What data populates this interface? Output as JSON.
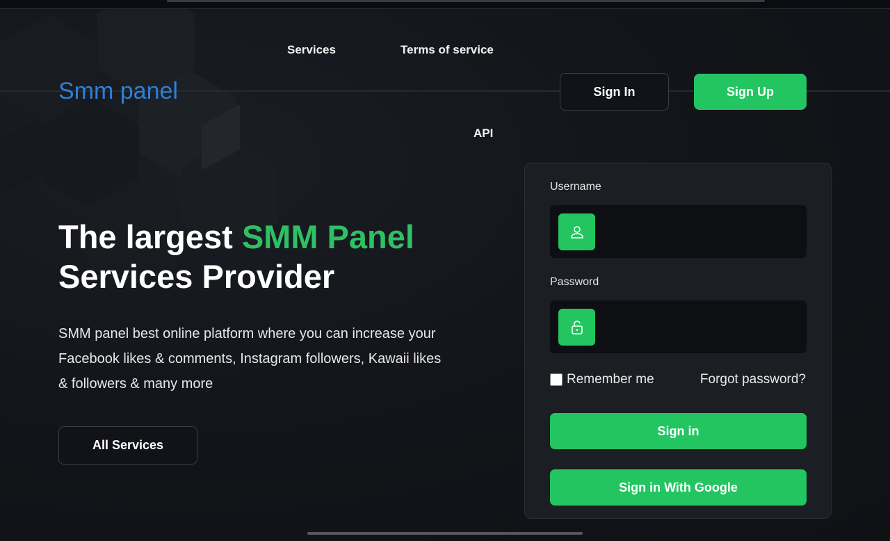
{
  "nav": {
    "services": "Services",
    "terms": "Terms of service",
    "api": "API"
  },
  "logo": "Smm panel",
  "header": {
    "signin_label": "Sign In",
    "signup_label": "Sign Up"
  },
  "hero": {
    "title_part1": "The largest ",
    "title_accent": "SMM Panel",
    "title_part2": "Services Provider",
    "description": "SMM panel best online platform where you can increase your Facebook likes & comments, Instagram followers, Kawaii likes & followers & many more",
    "all_services_label": "All Services"
  },
  "login": {
    "username_label": "Username",
    "username_icon": "user-icon",
    "password_label": "Password",
    "password_icon": "lock-icon",
    "remember_label": "Remember me",
    "remember_checked": false,
    "forgot_label": "Forgot password?",
    "signin_label": "Sign in",
    "google_label": "Sign in With Google"
  },
  "colors": {
    "accent_green": "#23c561",
    "logo_blue": "#2f7fd6",
    "background": "#111318",
    "card": "#1b1e23"
  }
}
